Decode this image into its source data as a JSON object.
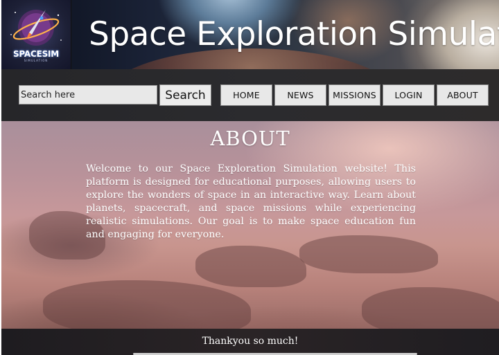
{
  "header": {
    "logo_text": "SPACESIM",
    "logo_subtext": "SIMULATION",
    "title": "Space Exploration Simulation"
  },
  "search": {
    "placeholder": "Search here",
    "button_label": "Search"
  },
  "nav": {
    "home": "HOME",
    "news": "NEWS",
    "missions": "MISSIONS",
    "login": "LOGIN",
    "about": "ABOUT"
  },
  "about": {
    "title": "ABOUT",
    "text": "Welcome to our Space Exploration Simulation website! This platform is designed for educational purposes, allowing users to explore the wonders of space in an interactive way. Learn about planets, spacecraft, and space missions while experiencing realistic simulations. Our goal is to make space education fun and engaging for everyone."
  },
  "footer": {
    "text": "Thankyou so much!"
  },
  "colors": {
    "nav_background": "#2b2b2e",
    "button_background": "#e8e8e8",
    "text_light": "#ffffff"
  }
}
